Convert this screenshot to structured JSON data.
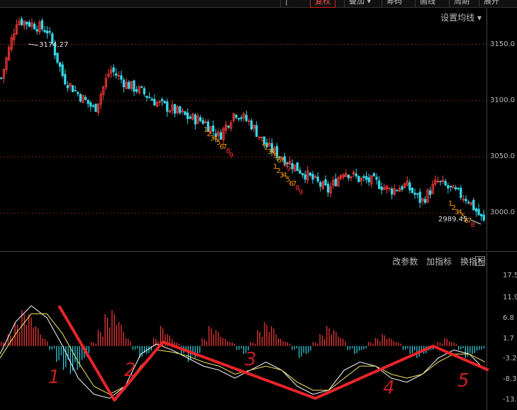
{
  "toolbar": {
    "items": [
      {
        "label": "|"
      },
      {
        "label": "复权",
        "active": true
      },
      {
        "label": "叠加 ▾"
      },
      {
        "label": "筹码"
      },
      {
        "label": "画线"
      },
      {
        "label": "周期"
      },
      {
        "label": "展开"
      }
    ],
    "ma_settings": "设置均线 ▾"
  },
  "indicator_bar": {
    "edit_params": "改参数",
    "add_indicator": "加指标",
    "switch_indicator": "换指标",
    "close": "✕"
  },
  "chart_data": [
    {
      "type": "candlestick",
      "yaxis_ticks": [
        "3150.0",
        "3100.0",
        "3050.0",
        "3000.0"
      ],
      "ylim": [
        2975,
        3180
      ],
      "high_marker": "3174.27",
      "low_marker": "2989.45",
      "colors": {
        "up": "#ff3b3b",
        "down": "#33d6e6",
        "td_count": "#ff9900",
        "td_nine": "#ff3030"
      },
      "trend_points": [
        3120,
        3172,
        3168,
        3162,
        3120,
        3105,
        3092,
        3128,
        3115,
        3108,
        3098,
        3092,
        3085,
        3082,
        3068,
        3090,
        3080,
        3060,
        3050,
        3040,
        3030,
        3020,
        3038,
        3030,
        3028,
        3020,
        3025,
        3010,
        3028,
        3020,
        3012,
        2992
      ],
      "td_sequences": [
        {
          "labels": [
            "1",
            "2",
            "3",
            "4",
            "5",
            "6",
            "7",
            "8",
            "9"
          ]
        },
        {
          "labels": [
            "1",
            "2",
            "3",
            "4",
            "5",
            "6",
            "7",
            "8",
            "9"
          ]
        },
        {
          "labels": [
            "1",
            "2",
            "3",
            "4",
            "5",
            "6",
            "7",
            "8",
            "9"
          ]
        },
        {
          "labels": [
            "1",
            "2",
            "3",
            "4",
            "5",
            "6",
            "7",
            "8"
          ]
        }
      ]
    },
    {
      "type": "macd",
      "yaxis_ticks": [
        "17.5",
        "11.9",
        "6.8",
        "1.7",
        "-3.2",
        "-8.3",
        "-13.5"
      ],
      "ylim": [
        -14.5,
        19
      ],
      "dif": [
        -2,
        6,
        10,
        7,
        0,
        -8,
        -12,
        -13,
        -10,
        -2,
        0.5,
        -1,
        -3,
        -5,
        -6,
        -8,
        -6,
        -4,
        -6,
        -10,
        -12,
        -11,
        -6,
        -4,
        -5,
        -8,
        -9,
        -7,
        -3,
        -1,
        -2,
        -6
      ],
      "dea": [
        -3,
        3,
        8,
        8,
        3,
        -4,
        -10,
        -12,
        -10,
        -5,
        -1,
        -1.5,
        -2.5,
        -4,
        -5,
        -7,
        -6,
        -5,
        -6,
        -9,
        -11,
        -11,
        -8,
        -5,
        -5,
        -7,
        -8,
        -7,
        -4,
        -2,
        -2,
        -4
      ],
      "histogram": [
        1,
        3,
        6,
        9,
        8,
        5,
        2,
        -1,
        -4,
        -6,
        -7,
        -6,
        -3,
        1,
        4,
        8,
        9,
        6,
        2,
        -1,
        -3,
        -2,
        2,
        5,
        3,
        1,
        -2,
        -4,
        -3,
        2,
        5,
        4,
        2,
        1,
        -1,
        -2,
        1,
        4,
        6,
        5,
        2,
        1,
        -1,
        -3,
        -2,
        1,
        3,
        5,
        4,
        2,
        -1,
        -2,
        -1,
        1,
        2,
        3,
        2,
        1,
        -1,
        -2,
        -3,
        -2,
        -1,
        1,
        2,
        1,
        -1,
        -3,
        -2,
        -1
      ],
      "annotation_wave_points": [
        [
          8,
          10
        ],
        [
          16,
          -13.5
        ],
        [
          23,
          1
        ],
        [
          45,
          -13
        ],
        [
          62,
          0
        ],
        [
          70,
          -6
        ]
      ],
      "annotation_labels": [
        "1",
        "2",
        "3",
        "4",
        "5"
      ]
    }
  ]
}
